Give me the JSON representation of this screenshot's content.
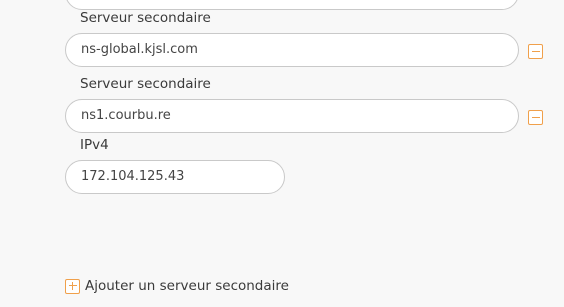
{
  "dns": {
    "secondary_servers": [
      {
        "label": "Serveur secondaire",
        "value": "ns-global.kjsl.com"
      },
      {
        "label": "Serveur secondaire",
        "value": "ns1.courbu.re"
      }
    ],
    "ipv4": {
      "label": "IPv4",
      "value": "172.104.125.43"
    },
    "add_secondary_label": "Ajouter un serveur secondaire"
  },
  "icons": {
    "remove": "minus-square-icon",
    "add": "plus-square-icon"
  },
  "colors": {
    "accent": "#f0a04b",
    "field_border": "#c9c9c9",
    "background": "#f8f8f8"
  }
}
